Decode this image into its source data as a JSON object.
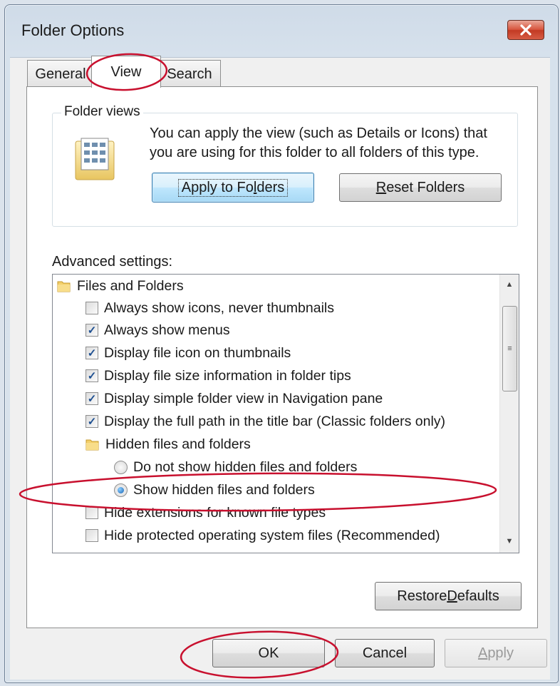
{
  "window": {
    "title": "Folder Options",
    "close_icon": "close-x"
  },
  "tabs": [
    {
      "label": "General",
      "selected": false
    },
    {
      "label": "View",
      "selected": true
    },
    {
      "label": "Search",
      "selected": false
    }
  ],
  "folder_views": {
    "legend": "Folder views",
    "description_line1": "You can apply the view (such as Details or Icons) that",
    "description_line2": "you are using for this folder to all folders of this type.",
    "apply_label_pre": "Apply to Fo",
    "apply_label_u": "l",
    "apply_label_post": "ders",
    "reset_label_u": "R",
    "reset_label_post": "eset Folders"
  },
  "advanced": {
    "label": "Advanced settings:",
    "items": [
      {
        "type": "folder",
        "label": "Files and Folders"
      },
      {
        "type": "checkbox",
        "label": "Always show icons, never thumbnails",
        "checked": false
      },
      {
        "type": "checkbox",
        "label": "Always show menus",
        "checked": true
      },
      {
        "type": "checkbox",
        "label": "Display file icon on thumbnails",
        "checked": true
      },
      {
        "type": "checkbox",
        "label": "Display file size information in folder tips",
        "checked": true
      },
      {
        "type": "checkbox",
        "label": "Display simple folder view in Navigation pane",
        "checked": true
      },
      {
        "type": "checkbox",
        "label": "Display the full path in the title bar (Classic folders only)",
        "checked": true
      },
      {
        "type": "folder",
        "label": "Hidden files and folders"
      },
      {
        "type": "radio",
        "label": "Do not show hidden files and folders",
        "checked": false
      },
      {
        "type": "radio",
        "label": "Show hidden files and folders",
        "checked": true
      },
      {
        "type": "checkbox",
        "label": "Hide extensions for known file types",
        "checked": false
      },
      {
        "type": "checkbox",
        "label": "Hide protected operating system files (Recommended)",
        "checked": false
      }
    ],
    "restore_label_pre": "Restore ",
    "restore_label_u": "D",
    "restore_label_post": "efaults"
  },
  "buttons": {
    "ok": "OK",
    "cancel": "Cancel",
    "apply_u": "A",
    "apply_post": "pply"
  },
  "colors": {
    "accent_focus": "#3c7fb1",
    "annotation": "#c8102e",
    "check": "#1d4f91"
  }
}
